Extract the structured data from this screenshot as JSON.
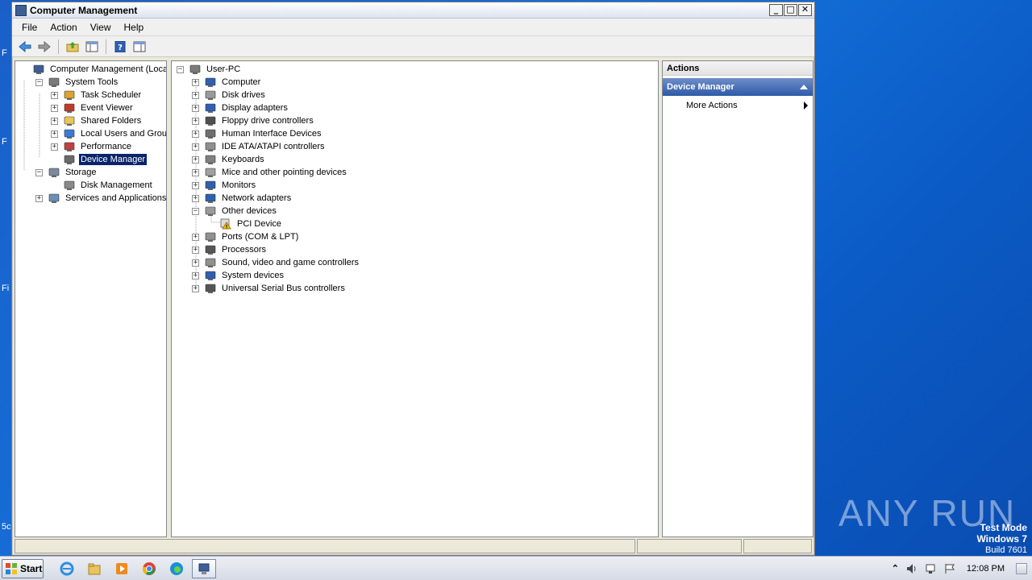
{
  "desktop": {
    "fragments": [
      "F",
      "F",
      "Fi",
      "5c"
    ]
  },
  "window": {
    "title": "Computer Management",
    "buttons": {
      "minimize": "_",
      "maximize": "□",
      "close": "✕"
    }
  },
  "menubar": [
    "File",
    "Action",
    "View",
    "Help"
  ],
  "left_tree": [
    {
      "label": "Computer Management (Local)",
      "level": 0,
      "expander": "",
      "icon": "computer-management-icon"
    },
    {
      "label": "System Tools",
      "level": 1,
      "expander": "−",
      "icon": "tools-icon"
    },
    {
      "label": "Task Scheduler",
      "level": 2,
      "expander": "+",
      "icon": "clock-icon"
    },
    {
      "label": "Event Viewer",
      "level": 2,
      "expander": "+",
      "icon": "event-viewer-icon"
    },
    {
      "label": "Shared Folders",
      "level": 2,
      "expander": "+",
      "icon": "shared-folder-icon"
    },
    {
      "label": "Local Users and Groups",
      "level": 2,
      "expander": "+",
      "icon": "users-icon"
    },
    {
      "label": "Performance",
      "level": 2,
      "expander": "+",
      "icon": "performance-icon"
    },
    {
      "label": "Device Manager",
      "level": 2,
      "expander": "",
      "icon": "device-manager-icon",
      "selected": true
    },
    {
      "label": "Storage",
      "level": 1,
      "expander": "−",
      "icon": "storage-icon"
    },
    {
      "label": "Disk Management",
      "level": 2,
      "expander": "",
      "icon": "disk-icon"
    },
    {
      "label": "Services and Applications",
      "level": 1,
      "expander": "+",
      "icon": "services-icon"
    }
  ],
  "device_tree": [
    {
      "label": "User-PC",
      "level": 0,
      "expander": "−",
      "icon": "pc-icon"
    },
    {
      "label": "Computer",
      "level": 1,
      "expander": "+",
      "icon": "computer-icon"
    },
    {
      "label": "Disk drives",
      "level": 1,
      "expander": "+",
      "icon": "disk-drive-icon"
    },
    {
      "label": "Display adapters",
      "level": 1,
      "expander": "+",
      "icon": "display-icon"
    },
    {
      "label": "Floppy drive controllers",
      "level": 1,
      "expander": "+",
      "icon": "floppy-icon"
    },
    {
      "label": "Human Interface Devices",
      "level": 1,
      "expander": "+",
      "icon": "hid-icon"
    },
    {
      "label": "IDE ATA/ATAPI controllers",
      "level": 1,
      "expander": "+",
      "icon": "ide-icon"
    },
    {
      "label": "Keyboards",
      "level": 1,
      "expander": "+",
      "icon": "keyboard-icon"
    },
    {
      "label": "Mice and other pointing devices",
      "level": 1,
      "expander": "+",
      "icon": "mouse-icon"
    },
    {
      "label": "Monitors",
      "level": 1,
      "expander": "+",
      "icon": "monitor-icon"
    },
    {
      "label": "Network adapters",
      "level": 1,
      "expander": "+",
      "icon": "network-icon"
    },
    {
      "label": "Other devices",
      "level": 1,
      "expander": "−",
      "icon": "other-devices-icon"
    },
    {
      "label": "PCI Device",
      "level": 2,
      "expander": "",
      "icon": "warning-device-icon"
    },
    {
      "label": "Ports (COM & LPT)",
      "level": 1,
      "expander": "+",
      "icon": "ports-icon"
    },
    {
      "label": "Processors",
      "level": 1,
      "expander": "+",
      "icon": "processor-icon"
    },
    {
      "label": "Sound, video and game controllers",
      "level": 1,
      "expander": "+",
      "icon": "sound-icon"
    },
    {
      "label": "System devices",
      "level": 1,
      "expander": "+",
      "icon": "system-icon"
    },
    {
      "label": "Universal Serial Bus controllers",
      "level": 1,
      "expander": "+",
      "icon": "usb-icon"
    }
  ],
  "actions": {
    "header": "Actions",
    "section": "Device Manager",
    "items": [
      "More Actions"
    ]
  },
  "taskbar": {
    "start": "Start",
    "apps": [
      "ie-icon",
      "explorer-icon",
      "media-player-icon",
      "chrome-icon",
      "edge-icon",
      "computer-management-icon"
    ],
    "clock": "12:08 PM"
  },
  "watermark": "ANY RUN",
  "test_mode": {
    "line1": "Test Mode",
    "line2": "Windows 7",
    "line3": "Build 7601"
  },
  "colors": {
    "selection": "#0a246a",
    "actions_section": "#2d5aa7",
    "desktop": "#1470d8"
  }
}
